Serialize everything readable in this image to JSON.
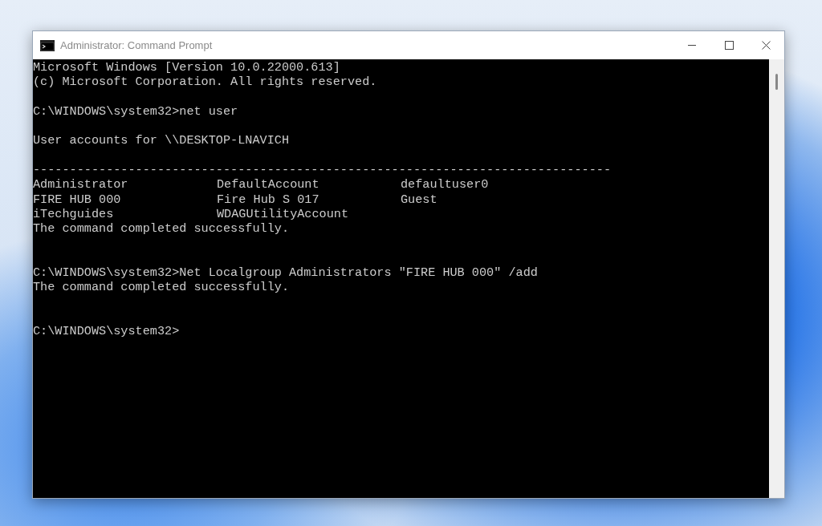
{
  "window": {
    "title": "Administrator: Command Prompt"
  },
  "console": {
    "lines": [
      {
        "kind": "text",
        "text": "Microsoft Windows [Version 10.0.22000.613]"
      },
      {
        "kind": "text",
        "text": "(c) Microsoft Corporation. All rights reserved."
      },
      {
        "kind": "blank"
      },
      {
        "kind": "text",
        "text": "C:\\WINDOWS\\system32>net user"
      },
      {
        "kind": "blank"
      },
      {
        "kind": "text",
        "text": "User accounts for \\\\DESKTOP-LNAVICH"
      },
      {
        "kind": "blank"
      },
      {
        "kind": "text",
        "text": "-------------------------------------------------------------------------------"
      },
      {
        "kind": "columns",
        "cells": [
          "Administrator",
          "DefaultAccount",
          "defaultuser0"
        ]
      },
      {
        "kind": "columns",
        "cells": [
          "FIRE HUB 000",
          "Fire Hub S 017",
          "Guest"
        ]
      },
      {
        "kind": "columns",
        "cells": [
          "iTechguides",
          "WDAGUtilityAccount"
        ]
      },
      {
        "kind": "text",
        "text": "The command completed successfully."
      },
      {
        "kind": "blank"
      },
      {
        "kind": "blank"
      },
      {
        "kind": "text",
        "text": "C:\\WINDOWS\\system32>Net Localgroup Administrators \"FIRE HUB 000\" /add"
      },
      {
        "kind": "text",
        "text": "The command completed successfully."
      },
      {
        "kind": "blank"
      },
      {
        "kind": "blank"
      },
      {
        "kind": "text",
        "text": "C:\\WINDOWS\\system32>"
      }
    ]
  }
}
